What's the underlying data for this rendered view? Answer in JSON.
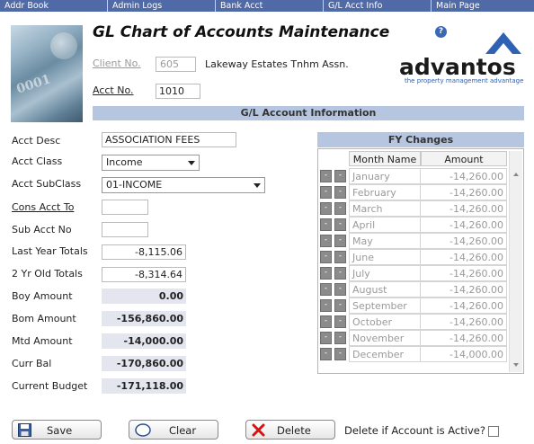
{
  "nav": [
    {
      "label": "Addr Book",
      "width": 120
    },
    {
      "label": "Admin Logs",
      "width": 120
    },
    {
      "label": "Bank Acct",
      "width": 120
    },
    {
      "label": "G/L Acct Info",
      "width": 120
    },
    {
      "label": "Main Page",
      "width": 114
    }
  ],
  "header": {
    "title": "GL Chart of Accounts Maintenance",
    "help": "?",
    "logo_word": "advantos",
    "logo_tagline": "the property management advantage"
  },
  "client": {
    "label": "Client No.",
    "value": "605",
    "name": "Lakeway Estates Tnhm Assn."
  },
  "acct": {
    "label": "Acct No.",
    "value": "1010"
  },
  "section_title": "G/L Account Information",
  "form": {
    "acct_desc": {
      "label": "Acct Desc",
      "value": "ASSOCIATION FEES"
    },
    "acct_class": {
      "label": "Acct Class",
      "value": "Income"
    },
    "acct_subclass": {
      "label": "Acct SubClass",
      "value": "01-INCOME"
    },
    "cons_acct": {
      "label": "Cons Acct To",
      "value": ""
    },
    "sub_acct": {
      "label": "Sub Acct No",
      "value": ""
    },
    "last_year": {
      "label": "Last Year Totals",
      "value": "-8,115.06"
    },
    "two_yr": {
      "label": "2 Yr Old Totals",
      "value": "-8,314.64"
    },
    "boy": {
      "label": "Boy Amount",
      "value": "0.00"
    },
    "bom": {
      "label": "Bom Amount",
      "value": "-156,860.00"
    },
    "mtd": {
      "label": "Mtd Amount",
      "value": "-14,000.00"
    },
    "curr_bal": {
      "label": "Curr Bal",
      "value": "-170,860.00"
    },
    "budget": {
      "label": "Current Budget",
      "value": "-171,118.00"
    }
  },
  "fy": {
    "title": "FY Changes",
    "col_month": "Month Name",
    "col_amount": "Amount",
    "rows": [
      {
        "month": "January",
        "amount": "-14,260.00"
      },
      {
        "month": "February",
        "amount": "-14,260.00"
      },
      {
        "month": "March",
        "amount": "-14,260.00"
      },
      {
        "month": "April",
        "amount": "-14,260.00"
      },
      {
        "month": "May",
        "amount": "-14,260.00"
      },
      {
        "month": "June",
        "amount": "-14,260.00"
      },
      {
        "month": "July",
        "amount": "-14,260.00"
      },
      {
        "month": "August",
        "amount": "-14,260.00"
      },
      {
        "month": "September",
        "amount": "-14,260.00"
      },
      {
        "month": "October",
        "amount": "-14,260.00"
      },
      {
        "month": "November",
        "amount": "-14,260.00"
      },
      {
        "month": "December",
        "amount": "-14,000.00"
      }
    ]
  },
  "buttons": {
    "save": "Save",
    "clear": "Clear",
    "delete": "Delete"
  },
  "delete_active_label": "Delete if Account is Active?",
  "colors": {
    "nav": "#4f6aa6",
    "section": "#b7c6e0",
    "brand_blue": "#2f62b3"
  }
}
